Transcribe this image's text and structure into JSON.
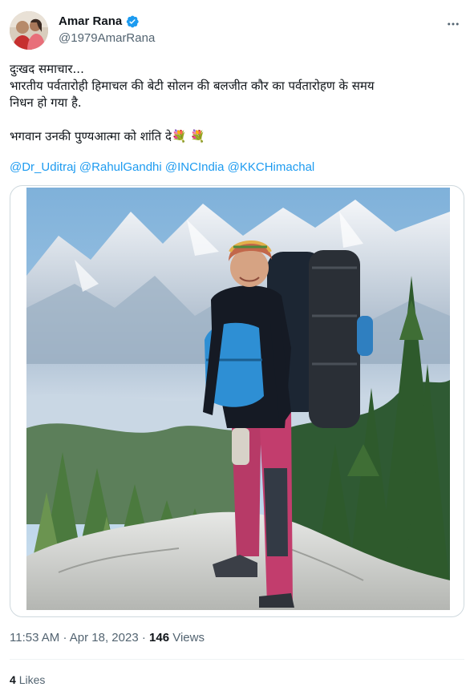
{
  "author": {
    "display_name": "Amar Rana",
    "handle": "@1979AmarRana",
    "verified": true
  },
  "tweet": {
    "lines": [
      "दुःखद समाचार...",
      "भारतीय पर्वतारोही हिमाचल की बेटी सोलन की बलजीत कौर का पर्वतारोहण के समय",
      "निधन हो गया है."
    ],
    "condolence": "भगवान उनकी पुण्यआत्मा को शांति दे💐 💐",
    "mentions": [
      "@Dr_Uditraj",
      "@RahulGandhi",
      "@INCIndia",
      "@KKCHimachal"
    ]
  },
  "meta": {
    "time": "11:53 AM",
    "separator": "·",
    "date": "Apr 18, 2023",
    "views_count": "146",
    "views_label": "Views"
  },
  "engagement": {
    "likes_count": "4",
    "likes_label": "Likes"
  },
  "icons": {
    "verified": "verified-badge-icon",
    "more": "more-options-icon"
  },
  "colors": {
    "link": "#1d9bf0",
    "secondary_text": "#536471",
    "primary_text": "#0f1419",
    "border": "#cfd9de"
  }
}
